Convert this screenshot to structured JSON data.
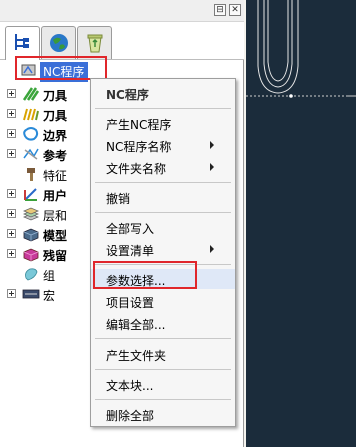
{
  "panel": {
    "pin_glyph": "⊟",
    "close_glyph": "✕",
    "tabs": [
      {
        "name": "explorer-tab",
        "icon": "tree-hierarchy-icon",
        "active": true
      },
      {
        "name": "globe-tab",
        "icon": "globe-icon",
        "active": false
      },
      {
        "name": "recycle-bin-tab",
        "icon": "recycle-bin-icon",
        "active": false
      }
    ]
  },
  "tree": {
    "root": {
      "label": "NC程序",
      "icon": "nc-program-icon"
    },
    "items": [
      {
        "label": "刀具",
        "icon": "tool-green-icon",
        "bold": true
      },
      {
        "label": "刀具",
        "icon": "toolpath-icon",
        "bold": true
      },
      {
        "label": "边界",
        "icon": "boundary-icon",
        "bold": true
      },
      {
        "label": "参考",
        "icon": "reference-icon",
        "bold": true
      },
      {
        "label": "特征",
        "icon": "feature-icon",
        "bold": false
      },
      {
        "label": "用户",
        "icon": "user-coordinate-icon",
        "bold": true
      },
      {
        "label": "层和",
        "icon": "layers-icon",
        "bold": false
      },
      {
        "label": "模型",
        "icon": "model-icon",
        "bold": false
      },
      {
        "label": "残留",
        "icon": "stock-model-icon",
        "bold": true
      },
      {
        "label": "组",
        "icon": "group-icon",
        "bold": false
      },
      {
        "label": "宏",
        "icon": "macro-icon",
        "bold": false
      }
    ]
  },
  "context_menu": {
    "header": "NC程序",
    "items": {
      "create": "产生NC程序",
      "nc_name": "NC程序名称",
      "folder_name": "文件夹名称",
      "undo": "撤销",
      "write_all": "全部写入",
      "settings_list": "设置清单",
      "param_select": "参数选择...",
      "project_settings": "项目设置",
      "edit_all": "编辑全部...",
      "create_folder": "产生文件夹",
      "text_block": "文本块...",
      "delete_all": "删除全部"
    }
  },
  "colors": {
    "selection": "#3a6fd8",
    "annotation": "#e0262b",
    "viewport_bg": "#1b2c3b",
    "toolpath": "#e6e6e6"
  }
}
